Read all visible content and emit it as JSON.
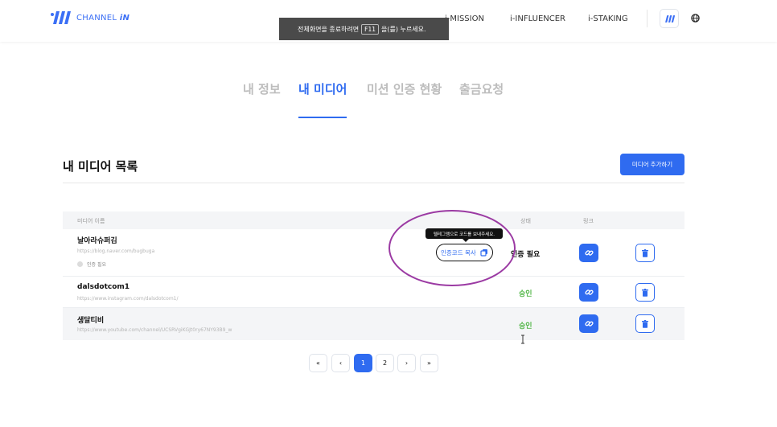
{
  "header": {
    "logo_text_prefix": "CHANNEL ",
    "logo_text_suffix": "iN",
    "nav": [
      "i-MISSION",
      "i-INFLUENCER",
      "i-STAKING"
    ],
    "icons": [
      "channel-in-logo-icon",
      "globe-icon"
    ]
  },
  "toast": {
    "before": "전체화면을 종료하려면",
    "key": "F11",
    "after": "을(를) 누르세요."
  },
  "tabs": [
    {
      "label": "내 정보",
      "active": false
    },
    {
      "label": "내 미디어",
      "active": true
    },
    {
      "label": "미션 인증 현황",
      "active": false
    },
    {
      "label": "출금요청",
      "active": false
    }
  ],
  "section": {
    "title": "내 미디어 목록",
    "add_button": "미디어 추가하기"
  },
  "table": {
    "headers": {
      "name": "미디어 이름",
      "status": "상태",
      "link": "링크"
    },
    "rows": [
      {
        "name": "날아라슈퍼김",
        "url": "https://blog.naver.com/bugbuga",
        "verify_label": "인증 필요",
        "copy_button": "인증코드 복사",
        "tooltip": "텔레그램으로 코드를 보내주세요.",
        "status": "인증 필요"
      },
      {
        "name": "dalsdotcom1",
        "url": "https://www.instagram.com/dalsdotcom1/",
        "status": "승인"
      },
      {
        "name": "생달티비",
        "url": "https://www.youtube.com/channel/UCSRVgiKGJt0ry67NY93B9_w",
        "status": "승인"
      }
    ]
  },
  "pagination": {
    "first": "«",
    "prev": "‹",
    "pages": [
      "1",
      "2"
    ],
    "current": "1",
    "next": "›",
    "last": "»"
  },
  "colors": {
    "accent": "#2f6bf0",
    "approved": "#56b84c",
    "annotation": "#9b3aa3",
    "toast_bg": "#4a4a4a"
  }
}
